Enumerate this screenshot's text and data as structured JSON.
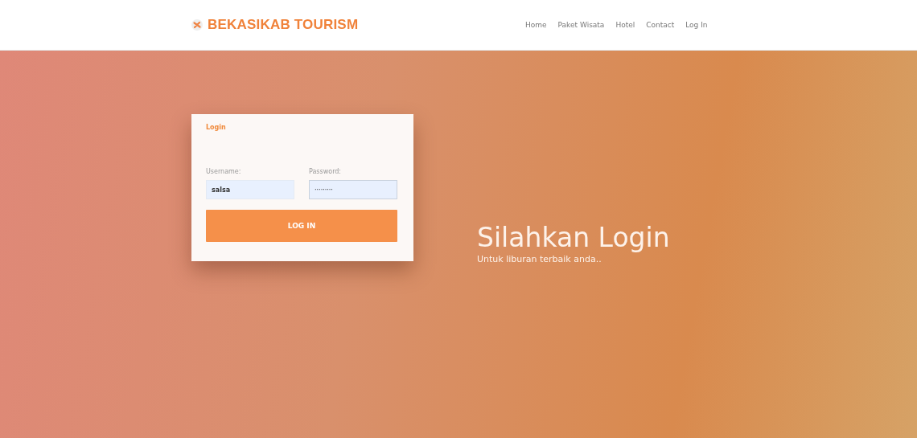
{
  "brand": {
    "name": "BEKASIKAB TOURISM"
  },
  "nav": [
    {
      "label": "Home"
    },
    {
      "label": "Paket Wisata"
    },
    {
      "label": "Hotel"
    },
    {
      "label": "Contact"
    },
    {
      "label": "Log In"
    }
  ],
  "login": {
    "title": "Login",
    "username": {
      "label": "Username:",
      "value": "salsa"
    },
    "password": {
      "label": "Password:",
      "value": "·········"
    },
    "button": "LOG IN"
  },
  "hero": {
    "title": "Silahkan Login",
    "subtitle": "Untuk liburan terbaik anda.."
  }
}
